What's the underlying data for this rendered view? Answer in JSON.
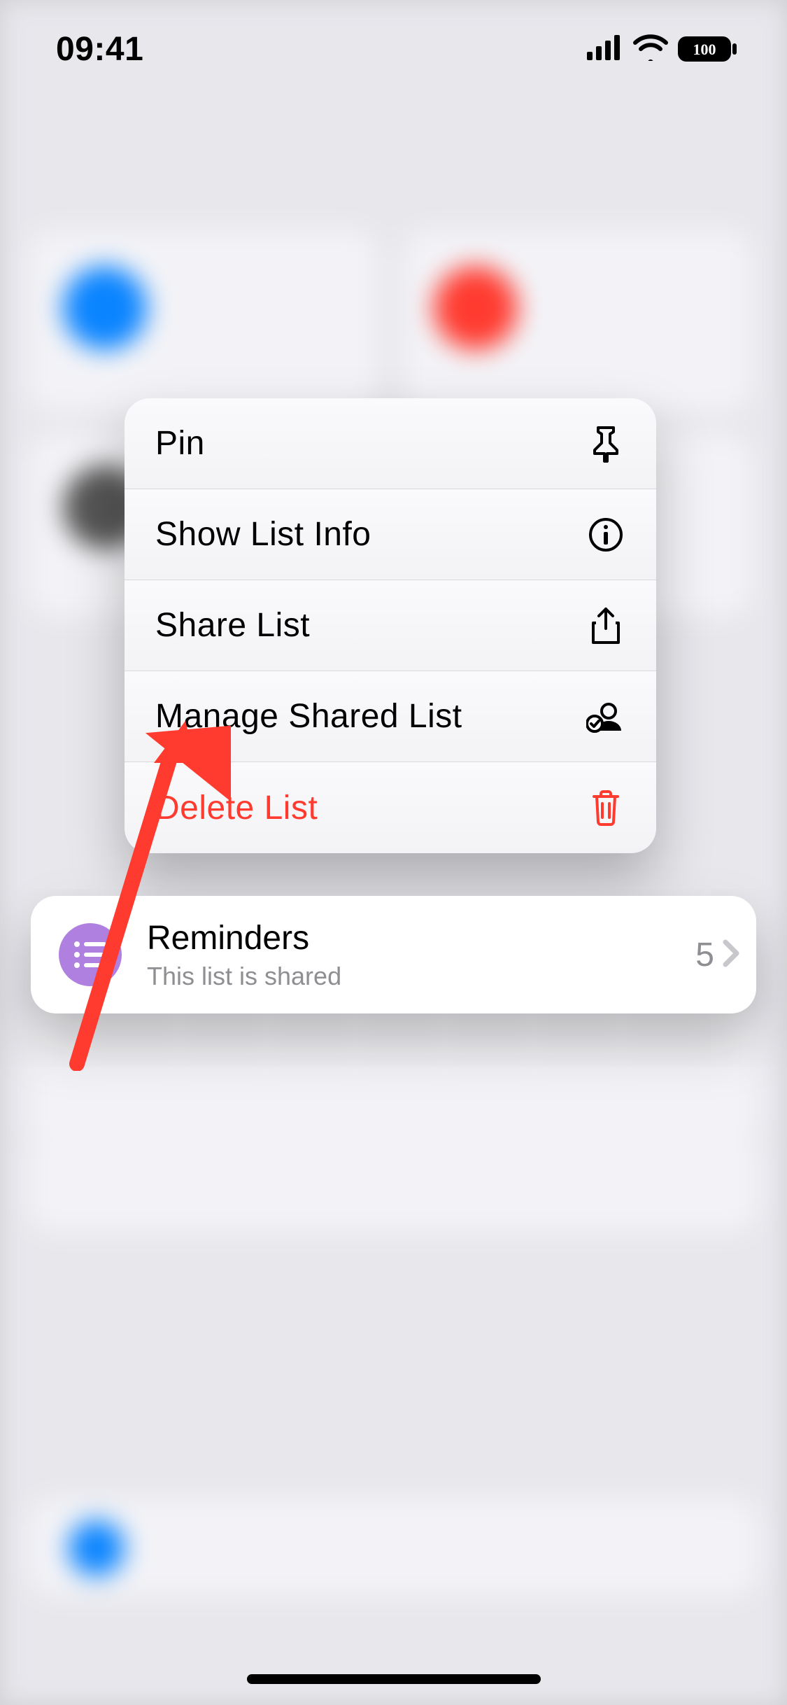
{
  "status_bar": {
    "time": "09:41",
    "battery_label": "100"
  },
  "menu": {
    "items": [
      {
        "label": "Pin",
        "icon": "pin-icon",
        "destructive": false
      },
      {
        "label": "Show List Info",
        "icon": "info-icon",
        "destructive": false
      },
      {
        "label": "Share List",
        "icon": "share-icon",
        "destructive": false
      },
      {
        "label": "Manage Shared List",
        "icon": "manage-shared-icon",
        "destructive": false
      },
      {
        "label": "Delete List",
        "icon": "trash-icon",
        "destructive": true
      }
    ]
  },
  "list": {
    "title": "Reminders",
    "subtitle": "This list is shared",
    "count": "5",
    "icon_color": "#b080e0"
  },
  "annotation": {
    "type": "arrow",
    "color": "#ff3b2f",
    "target": "manage-shared-list-menu-item"
  }
}
